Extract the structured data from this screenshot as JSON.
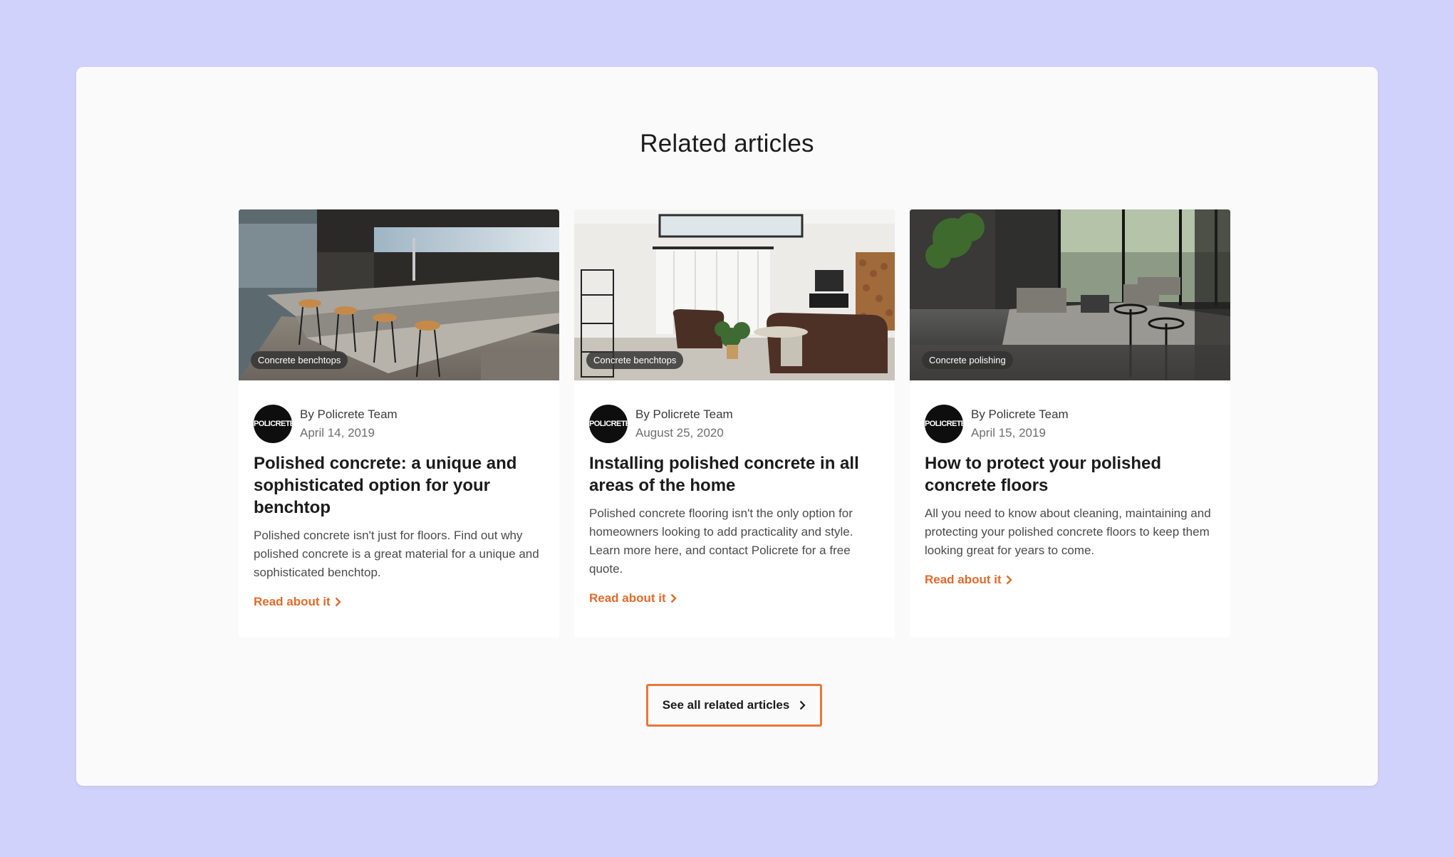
{
  "section": {
    "title": "Related articles"
  },
  "articles": [
    {
      "tag": "Concrete benchtops",
      "author": "By Policrete Team",
      "date": "April 14, 2019",
      "title": "Polished concrete: a unique and sophisticated option for your benchtop",
      "excerpt": "Polished concrete isn't just for floors. Find out why polished concrete is a great material for a unique and sophisticated benchtop.",
      "link": "Read about it",
      "avatar_logo": "POLICRETE"
    },
    {
      "tag": "Concrete benchtops",
      "author": "By Policrete Team",
      "date": "August 25, 2020",
      "title": "Installing polished concrete in all areas of the home",
      "excerpt": "Polished concrete flooring isn't the only option for homeowners looking to add practicality and style. Learn more here, and contact Policrete for a free quote.",
      "link": "Read about it",
      "avatar_logo": "POLICRETE"
    },
    {
      "tag": "Concrete polishing",
      "author": "By Policrete Team",
      "date": "April 15, 2019",
      "title": "How to protect your polished concrete floors",
      "excerpt": "All you need to know about cleaning, maintaining and protecting your polished concrete floors to keep them looking great for years to come.",
      "link": "Read about it",
      "avatar_logo": "POLICRETE"
    }
  ],
  "see_all": {
    "label": "See all related articles",
    "icon": "chevron-right-icon"
  },
  "colors": {
    "accent": "#e06a2a",
    "button_border": "#e8773a",
    "page_bg": "#d1d2fb",
    "panel_bg": "#fafafa"
  }
}
